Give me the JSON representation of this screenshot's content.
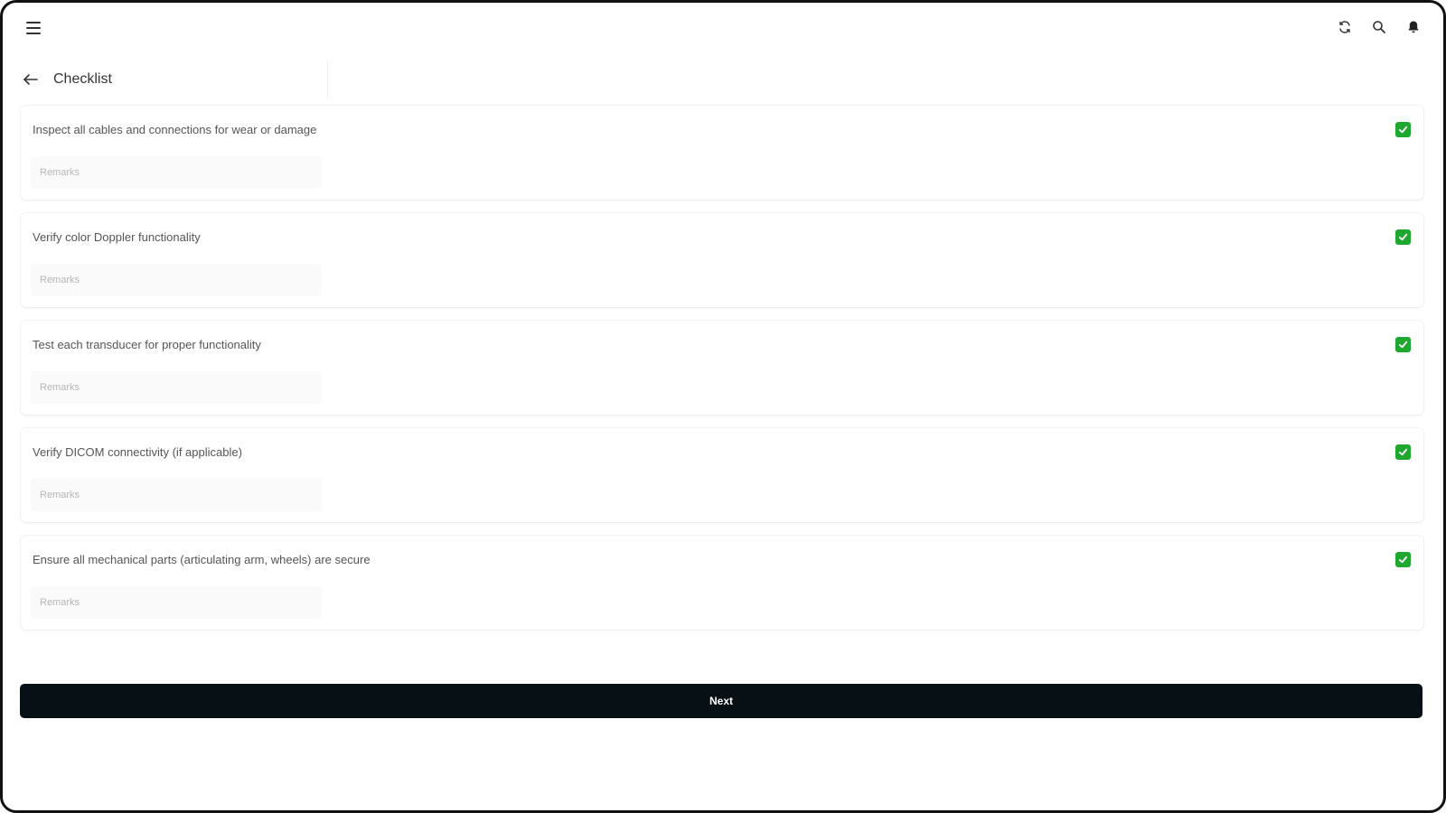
{
  "header": {
    "title": "Checklist"
  },
  "icons": {
    "menu": "menu-icon",
    "sync": "sync-icon",
    "search": "search-icon",
    "notifications": "bell-icon",
    "back": "arrow-left-icon",
    "checkbox": "checkbox-checked-icon"
  },
  "colors": {
    "checked": "#1fa82f",
    "primary_button": "#071015"
  },
  "checklist": {
    "items": [
      {
        "label": "Inspect all cables and connections for wear or damage",
        "remarks_placeholder": "Remarks",
        "remarks_value": "",
        "checked": true
      },
      {
        "label": "Verify color Doppler functionality",
        "remarks_placeholder": "Remarks",
        "remarks_value": "",
        "checked": true
      },
      {
        "label": "Test each transducer for proper functionality",
        "remarks_placeholder": "Remarks",
        "remarks_value": "",
        "checked": true
      },
      {
        "label": "Verify DICOM connectivity (if applicable)",
        "remarks_placeholder": "Remarks",
        "remarks_value": "",
        "checked": true
      },
      {
        "label": "Ensure all mechanical parts (articulating arm, wheels) are secure",
        "remarks_placeholder": "Remarks",
        "remarks_value": "",
        "checked": true
      }
    ]
  },
  "footer": {
    "next_label": "Next"
  }
}
